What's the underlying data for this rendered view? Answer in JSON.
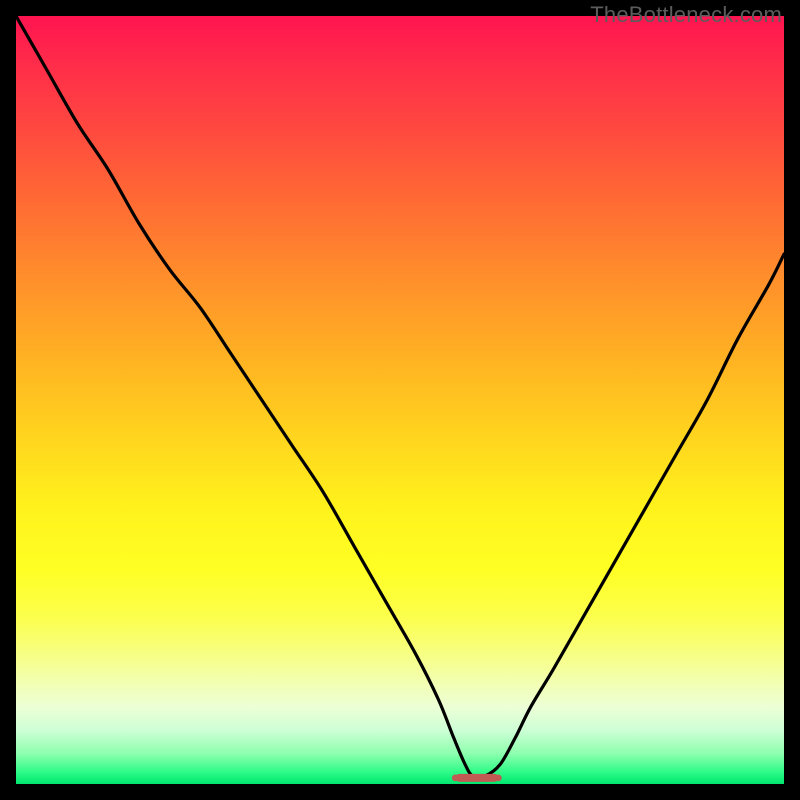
{
  "watermark": {
    "text": "TheBottleneck.com"
  },
  "chart_data": {
    "type": "line",
    "title": "",
    "xlabel": "",
    "ylabel": "",
    "xlim": [
      0,
      100
    ],
    "ylim": [
      0,
      100
    ],
    "grid": false,
    "legend": false,
    "annotations": [],
    "series": [
      {
        "name": "bottleneck-curve",
        "color": "#000000",
        "x": [
          0,
          4,
          8,
          12,
          16,
          20,
          24,
          28,
          32,
          36,
          40,
          44,
          48,
          52,
          55,
          57,
          58.5,
          59.5,
          61,
          63,
          65,
          67,
          70,
          74,
          78,
          82,
          86,
          90,
          94,
          98,
          100
        ],
        "values": [
          100,
          93,
          86,
          80,
          73,
          67,
          62,
          56,
          50,
          44,
          38,
          31,
          24,
          17,
          11,
          6,
          2.5,
          1,
          1,
          2.5,
          6,
          10,
          15,
          22,
          29,
          36,
          43,
          50,
          58,
          65,
          69
        ]
      },
      {
        "name": "minimum-marker",
        "color": "#c05a52",
        "type_hint": "marker-strip",
        "x": [
          57.2,
          58.0,
          58.8,
          59.6,
          60.4,
          61.2,
          62.0,
          62.8
        ],
        "values": [
          0.8,
          0.8,
          0.8,
          0.8,
          0.8,
          0.8,
          0.8,
          0.8
        ]
      }
    ],
    "background_gradient": {
      "direction": "top-to-bottom",
      "stops": [
        {
          "pos": 0,
          "color": "#ff1450"
        },
        {
          "pos": 0.5,
          "color": "#ffd21e"
        },
        {
          "pos": 0.78,
          "color": "#fcff4a"
        },
        {
          "pos": 1.0,
          "color": "#00e56f"
        }
      ]
    }
  }
}
